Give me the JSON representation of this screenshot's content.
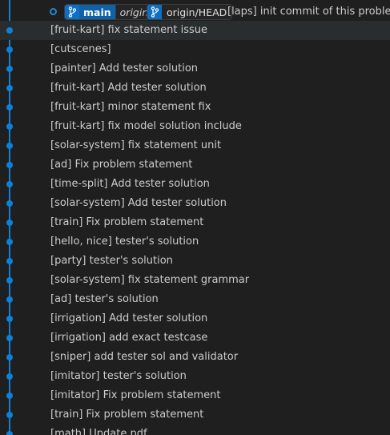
{
  "head_commit": {
    "branch": "main",
    "remote": "origin",
    "remote_head": "origin/HEAD",
    "message": "[laps] init commit of this problem"
  },
  "commits": [
    {
      "message": "[fruit-kart] fix statement issue"
    },
    {
      "message": "[cutscenes]"
    },
    {
      "message": "[painter] Add tester solution"
    },
    {
      "message": "[fruit-kart] Add tester solution"
    },
    {
      "message": "[fruit-kart] minor statement fix"
    },
    {
      "message": "[fruit-kart] fix model solution include"
    },
    {
      "message": "[solar-system] fix statement unit"
    },
    {
      "message": "[ad] Fix problem statement"
    },
    {
      "message": "[time-split] Add tester solution"
    },
    {
      "message": "[solar-system] Add tester solution"
    },
    {
      "message": "[train] Fix problem statement"
    },
    {
      "message": "[hello, nice] tester's solution"
    },
    {
      "message": "[party] tester's solution"
    },
    {
      "message": "[solar-system] fix statement grammar"
    },
    {
      "message": "[ad] tester's solution"
    },
    {
      "message": "[irrigation] Add tester solution"
    },
    {
      "message": "[irrigation] add exact testcase"
    },
    {
      "message": "[sniper] add tester sol and validator"
    },
    {
      "message": "[imitator] tester's solution"
    },
    {
      "message": "[imitator] Fix problem statement"
    },
    {
      "message": "[train] Fix problem statement"
    },
    {
      "message": "[math] Update pdf"
    }
  ],
  "colors": {
    "lane": "#0d80d8",
    "badge_branch": "#0e63a8",
    "background": "#1f1f1f"
  },
  "icons": {
    "branch": "git-branch-icon",
    "head": "head-commit-icon"
  }
}
